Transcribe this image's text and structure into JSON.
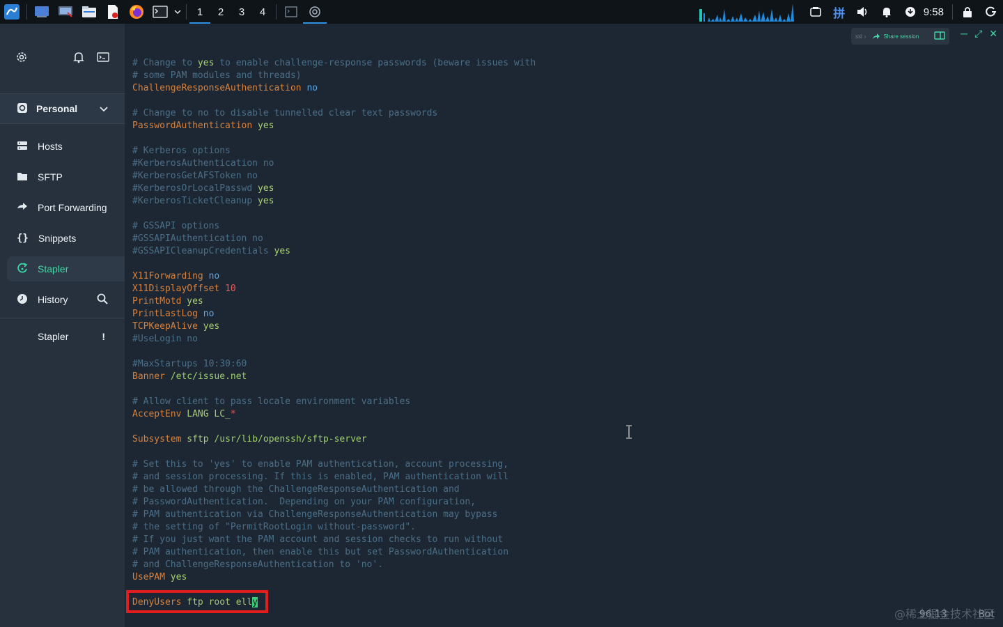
{
  "taskbar": {
    "workspaces": [
      "1",
      "2",
      "3",
      "4"
    ],
    "active_workspace": "1",
    "clock": "9:58",
    "accent": "#2f8fe0"
  },
  "sidebar": {
    "vault": "Personal",
    "items": [
      {
        "label": "Hosts",
        "icon": "hosts-icon"
      },
      {
        "label": "SFTP",
        "icon": "folder-icon"
      },
      {
        "label": "Port Forwarding",
        "icon": "arrow-forward-icon"
      },
      {
        "label": "Snippets",
        "icon": "braces-icon"
      },
      {
        "label": "Stapler",
        "icon": "stapler-icon",
        "active": true
      },
      {
        "label": "History",
        "icon": "clock-icon"
      }
    ],
    "bottom_item": {
      "label": "Stapler",
      "badge": "!"
    },
    "accent": "#3fd9a6"
  },
  "terminal": {
    "session_bar": {
      "left": "ssl",
      "share": "Share session"
    },
    "lines": [
      [
        [
          "c-comment",
          "# Change to "
        ],
        [
          "c-val",
          "yes"
        ],
        [
          "c-comment",
          " to enable challenge-response passwords (beware issues with"
        ]
      ],
      [
        [
          "c-comment",
          "# some PAM modules and threads)"
        ]
      ],
      [
        [
          "c-key",
          "ChallengeResponseAuthentication"
        ],
        [
          "c-plain",
          " "
        ],
        [
          "c-bool",
          "no"
        ]
      ],
      [],
      [
        [
          "c-comment",
          "# Change to no to disable tunnelled clear text passwords"
        ]
      ],
      [
        [
          "c-key",
          "PasswordAuthentication"
        ],
        [
          "c-plain",
          " "
        ],
        [
          "c-val",
          "yes"
        ]
      ],
      [],
      [
        [
          "c-comment",
          "# Kerberos options"
        ]
      ],
      [
        [
          "c-comment",
          "#KerberosAuthentication no"
        ]
      ],
      [
        [
          "c-comment",
          "#KerberosGetAFSToken no"
        ]
      ],
      [
        [
          "c-comment",
          "#KerberosOrLocalPasswd "
        ],
        [
          "c-val",
          "yes"
        ]
      ],
      [
        [
          "c-comment",
          "#KerberosTicketCleanup "
        ],
        [
          "c-val",
          "yes"
        ]
      ],
      [],
      [
        [
          "c-comment",
          "# GSSAPI options"
        ]
      ],
      [
        [
          "c-comment",
          "#GSSAPIAuthentication no"
        ]
      ],
      [
        [
          "c-comment",
          "#GSSAPICleanupCredentials "
        ],
        [
          "c-val",
          "yes"
        ]
      ],
      [],
      [
        [
          "c-key",
          "X11Forwarding"
        ],
        [
          "c-plain",
          " "
        ],
        [
          "c-bool",
          "no"
        ]
      ],
      [
        [
          "c-key",
          "X11DisplayOffset"
        ],
        [
          "c-plain",
          " "
        ],
        [
          "c-num",
          "10"
        ]
      ],
      [
        [
          "c-key",
          "PrintMotd"
        ],
        [
          "c-plain",
          " "
        ],
        [
          "c-val",
          "yes"
        ]
      ],
      [
        [
          "c-key",
          "PrintLastLog"
        ],
        [
          "c-plain",
          " "
        ],
        [
          "c-bool",
          "no"
        ]
      ],
      [
        [
          "c-key",
          "TCPKeepAlive"
        ],
        [
          "c-plain",
          " "
        ],
        [
          "c-val",
          "yes"
        ]
      ],
      [
        [
          "c-comment",
          "#UseLogin no"
        ]
      ],
      [],
      [
        [
          "c-comment",
          "#MaxStartups 10:30:60"
        ]
      ],
      [
        [
          "c-key",
          "Banner"
        ],
        [
          "c-plain",
          " "
        ],
        [
          "c-path",
          "/etc/issue.net"
        ]
      ],
      [],
      [
        [
          "c-comment",
          "# Allow client to pass locale environment variables"
        ]
      ],
      [
        [
          "c-key",
          "AcceptEnv"
        ],
        [
          "c-plain",
          " LANG LC_"
        ],
        [
          "c-star",
          "*"
        ]
      ],
      [],
      [
        [
          "c-key",
          "Subsystem"
        ],
        [
          "c-plain",
          " sftp "
        ],
        [
          "c-path",
          "/usr/lib/openssh/sftp-server"
        ]
      ],
      [],
      [
        [
          "c-comment",
          "# Set this to 'yes' to enable PAM authentication, account processing,"
        ]
      ],
      [
        [
          "c-comment",
          "# and session processing. If this is enabled, PAM authentication will"
        ]
      ],
      [
        [
          "c-comment",
          "# be allowed through the ChallengeResponseAuthentication and"
        ]
      ],
      [
        [
          "c-comment",
          "# PasswordAuthentication.  Depending on your PAM configuration,"
        ]
      ],
      [
        [
          "c-comment",
          "# PAM authentication via ChallengeResponseAuthentication may bypass"
        ]
      ],
      [
        [
          "c-comment",
          "# the setting of \"PermitRootLogin without-password\"."
        ]
      ],
      [
        [
          "c-comment",
          "# If you just want the PAM account and session checks to run without"
        ]
      ],
      [
        [
          "c-comment",
          "# PAM authentication, then enable this but set PasswordAuthentication"
        ]
      ],
      [
        [
          "c-comment",
          "# and ChallengeResponseAuthentication to 'no'."
        ]
      ],
      [
        [
          "c-key",
          "UsePAM"
        ],
        [
          "c-plain",
          " "
        ],
        [
          "c-val",
          "yes"
        ]
      ],
      [],
      [
        [
          "c-key",
          "DenyUsers"
        ],
        [
          "c-plain",
          " ftp root ell"
        ],
        [
          "cursor",
          "y"
        ]
      ]
    ],
    "status": "96,13          Bot",
    "watermark": "@稀土掘金技术社区"
  }
}
